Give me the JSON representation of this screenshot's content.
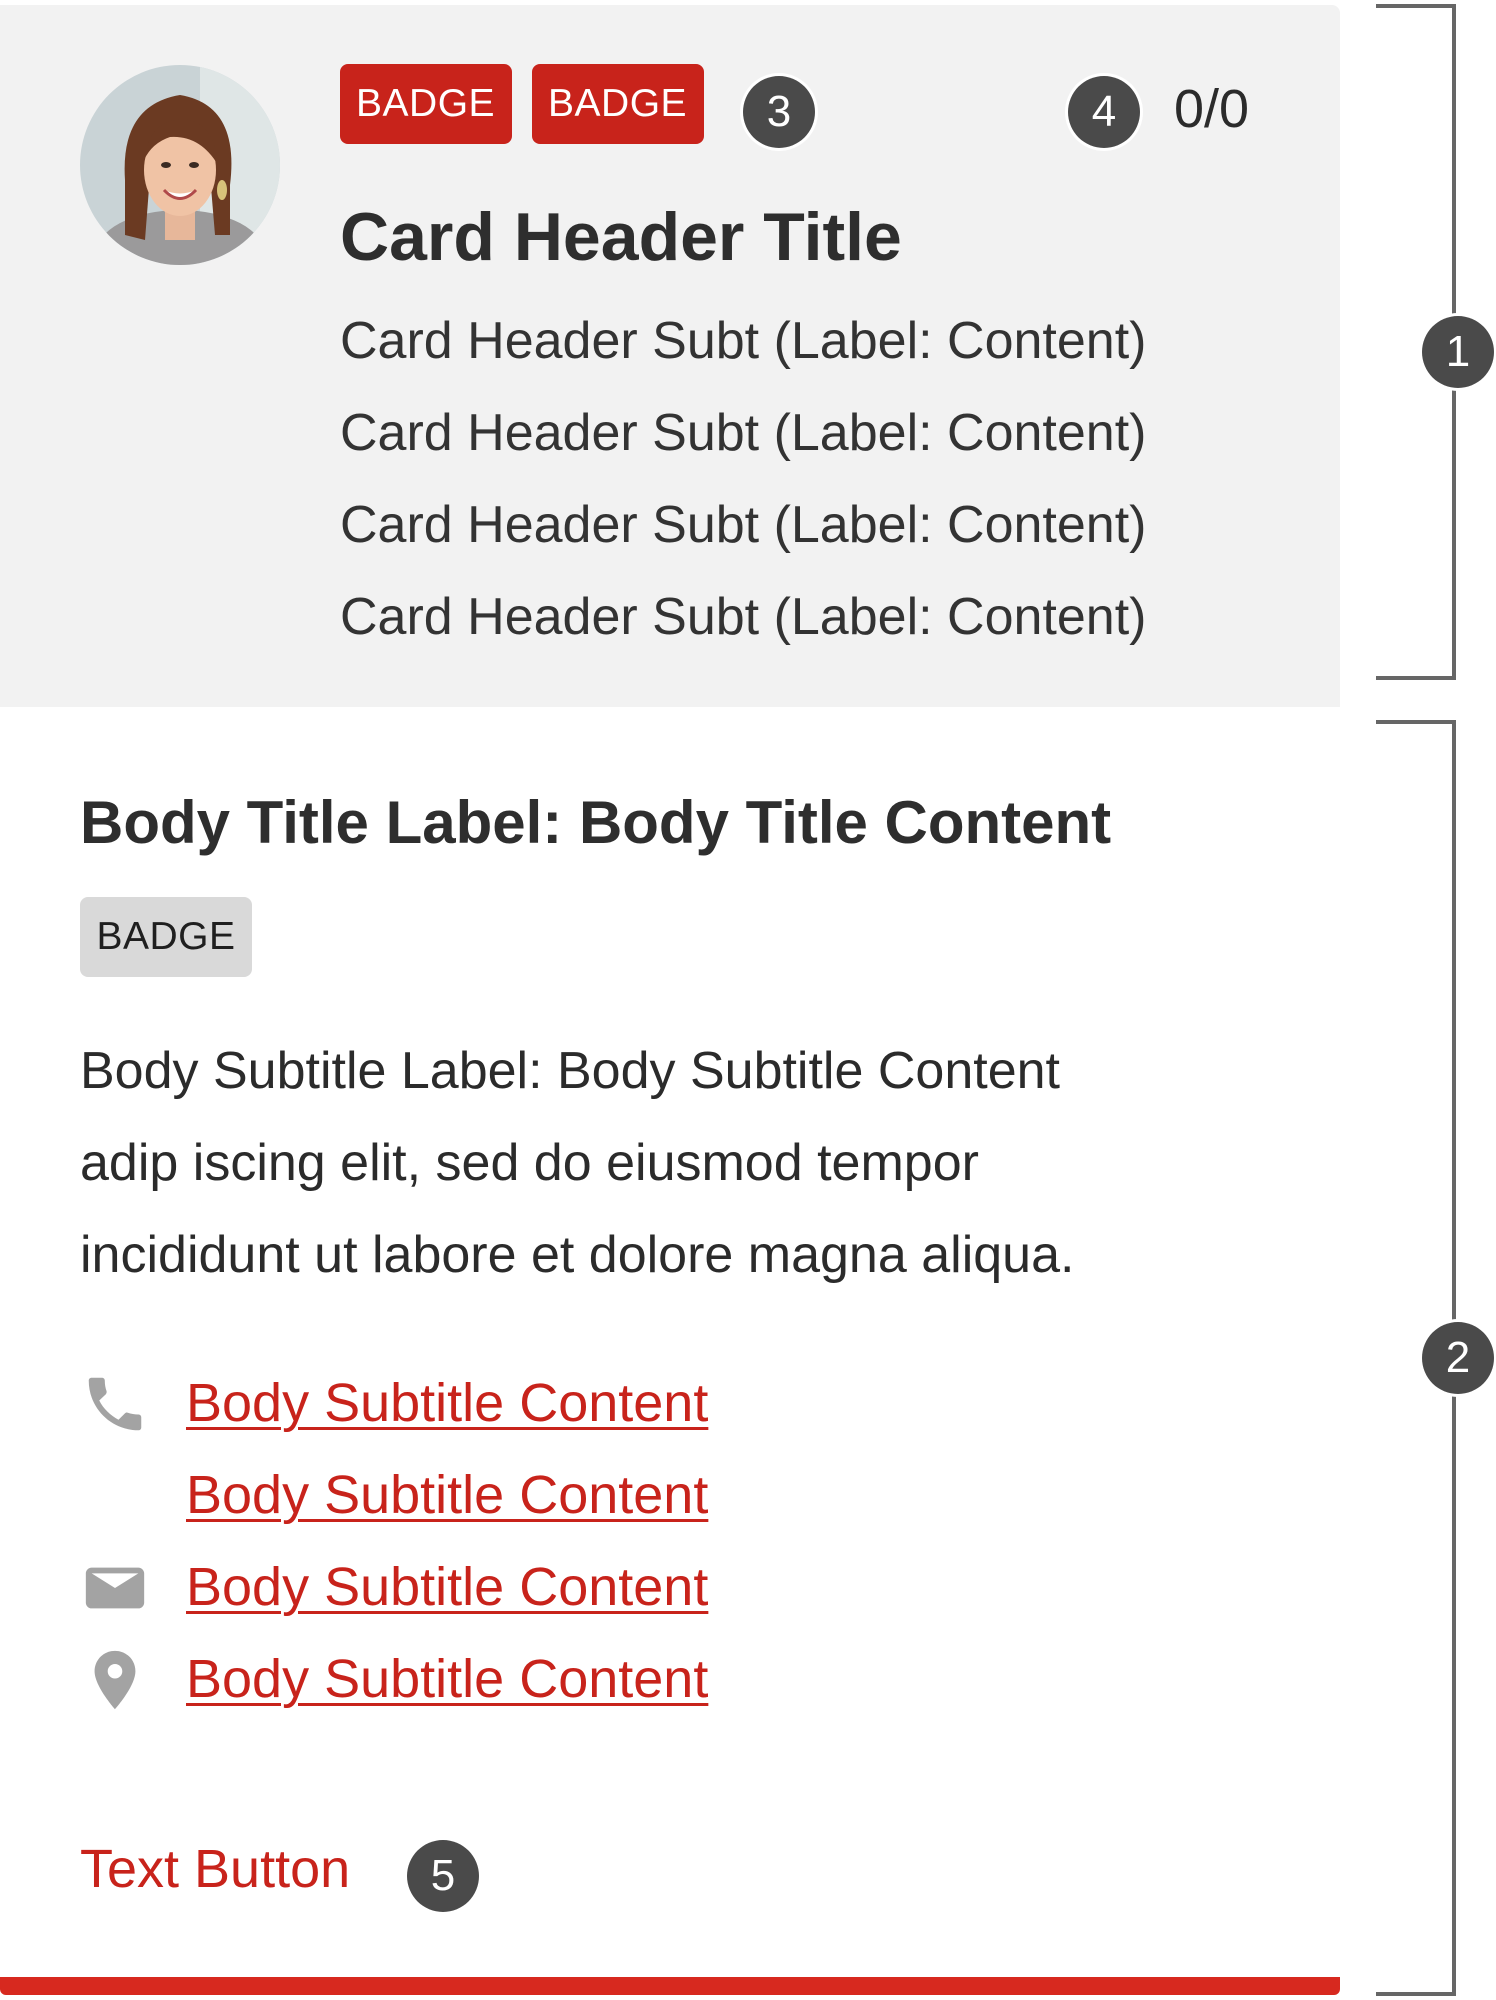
{
  "header": {
    "avatar_alt": "Profile photo",
    "badges": [
      "BADGE",
      "BADGE"
    ],
    "counter": "0/0",
    "title": "Card Header Title",
    "subtitles": [
      "Card Header Subt (Label: Content)",
      "Card Header Subt (Label: Content)",
      "Card Header Subt (Label: Content)",
      "Card Header Subt (Label: Content)"
    ]
  },
  "body": {
    "title": "Body Title Label: Body Title Content",
    "badge": "BADGE",
    "text_lines": [
      "Body Subtitle Label: Body Subtitle Content",
      "adip iscing elit, sed do eiusmod tempor",
      "incididunt ut labore et dolore magna aliqua."
    ],
    "contacts": [
      {
        "icon": "phone-icon",
        "link": "Body Subtitle Content"
      },
      {
        "icon": "",
        "link": "Body Subtitle Content"
      },
      {
        "icon": "mail-icon",
        "link": "Body Subtitle Content"
      },
      {
        "icon": "location-pin-icon",
        "link": "Body Subtitle Content"
      }
    ],
    "text_button": "Text Button"
  },
  "annotations": {
    "markers": [
      "1",
      "2",
      "3",
      "4",
      "5"
    ]
  },
  "colors": {
    "accent": "#c8231b",
    "header_bg": "#f2f2f2",
    "marker_bg": "#4a4a4a",
    "icon_grey": "#a3a3a3",
    "grey_badge": "#d9d9d9"
  }
}
